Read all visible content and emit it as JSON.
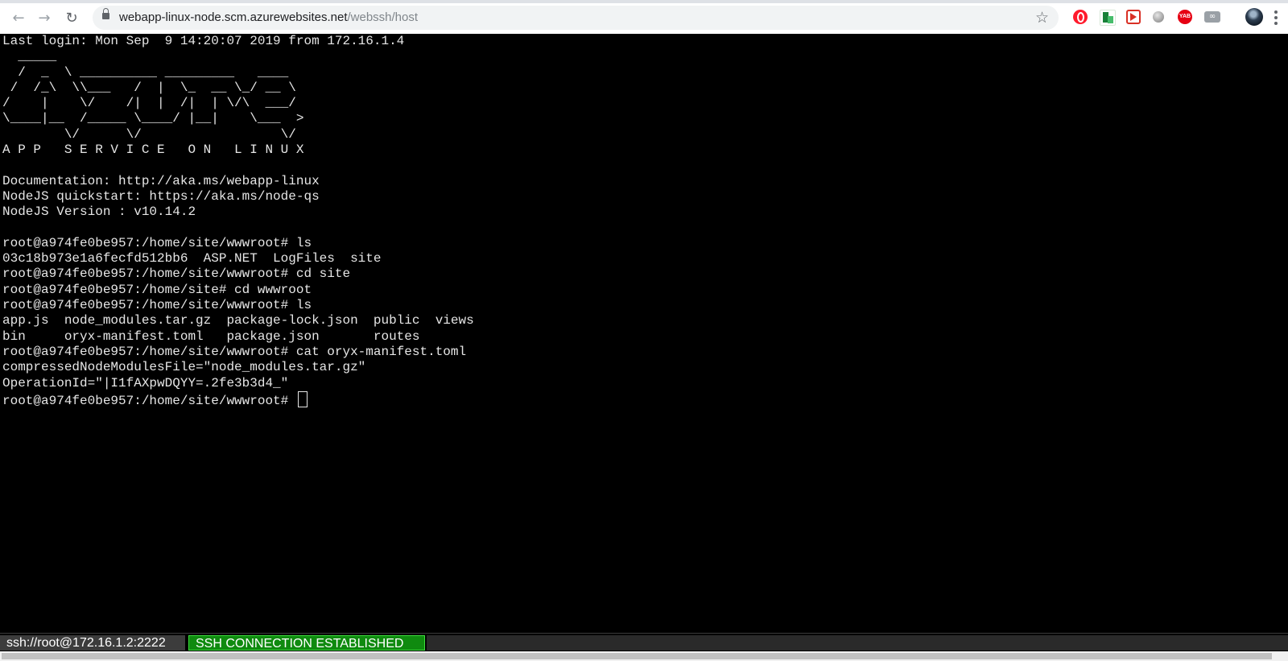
{
  "browser": {
    "url_host": "webapp-linux-node.scm.azurewebsites.net",
    "url_path": "/webssh/host",
    "nav": {
      "back_icon": "←",
      "forward_icon": "→",
      "reload_icon": "↻"
    },
    "star_icon": "☆",
    "extensions": {
      "opera": "opera-icon",
      "sheets": "sheets-icon",
      "video": "video-downloader-icon",
      "grey": "circle-icon",
      "yab": "YAB",
      "infinity": "∞"
    }
  },
  "terminal": {
    "lines": [
      "Last login: Mon Sep  9 14:20:07 2019 from 172.16.1.4",
      "  _____",
      "  /  _  \\ __________ _________   ____",
      " /  /_\\  \\\\___   /  |  \\_  __ \\_/ __ \\",
      "/    |    \\/    /|  |  /|  | \\/\\  ___/",
      "\\____|__  /_____ \\____/ |__|    \\___  >",
      "        \\/      \\/                  \\/",
      "A P P   S E R V I C E   O N   L I N U X",
      "",
      "Documentation: http://aka.ms/webapp-linux",
      "NodeJS quickstart: https://aka.ms/node-qs",
      "NodeJS Version : v10.14.2",
      "",
      "root@a974fe0be957:/home/site/wwwroot# ls",
      "03c18b973e1a6fecfd512bb6  ASP.NET  LogFiles  site",
      "root@a974fe0be957:/home/site/wwwroot# cd site",
      "root@a974fe0be957:/home/site# cd wwwroot",
      "root@a974fe0be957:/home/site/wwwroot# ls",
      "app.js  node_modules.tar.gz  package-lock.json  public  views",
      "bin     oryx-manifest.toml   package.json       routes",
      "root@a974fe0be957:/home/site/wwwroot# cat oryx-manifest.toml",
      "compressedNodeModulesFile=\"node_modules.tar.gz\"",
      "OperationId=\"|I1fAXpwDQYY=.2fe3b3d4_\""
    ],
    "prompt": "root@a974fe0be957:/home/site/wwwroot# "
  },
  "statusbar": {
    "host": "ssh://root@172.16.1.2:2222",
    "status": "SSH CONNECTION ESTABLISHED"
  }
}
